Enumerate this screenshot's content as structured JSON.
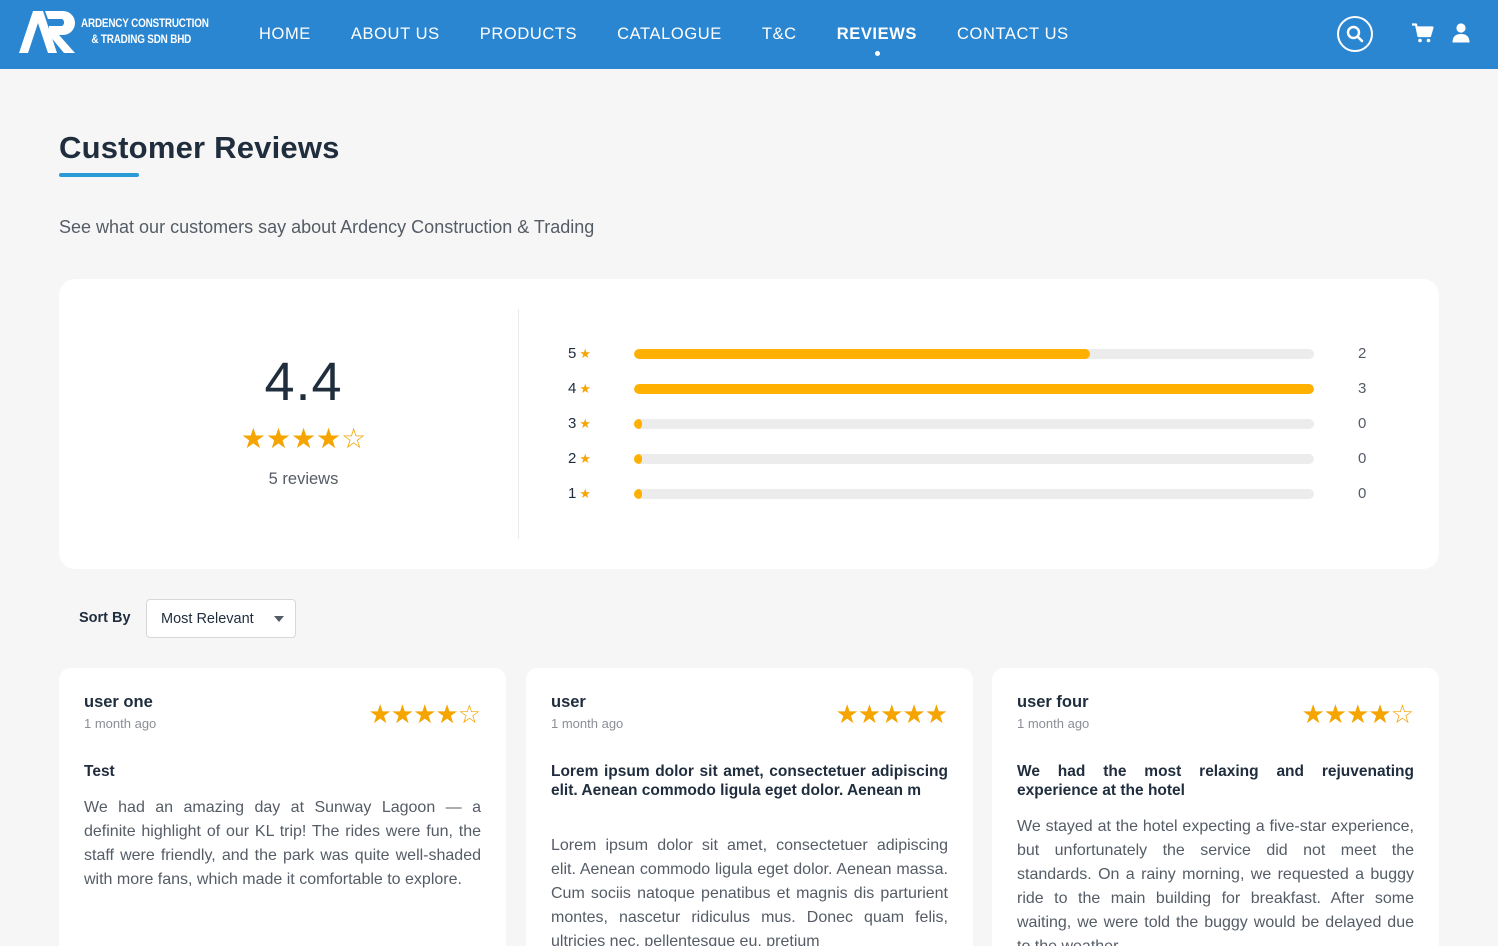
{
  "brand": {
    "name_line1": "ARDENCY CONSTRUCTION",
    "name_line2": "& TRADING SDN BHD",
    "logo_icon": "ar-logo-mark",
    "color": "#2b86d1"
  },
  "nav": {
    "items": [
      {
        "label": "HOME"
      },
      {
        "label": "ABOUT US"
      },
      {
        "label": "PRODUCTS"
      },
      {
        "label": "CATALOGUE"
      },
      {
        "label": "T&C"
      },
      {
        "label": "REVIEWS",
        "active": true
      },
      {
        "label": "CONTACT US"
      }
    ],
    "icons": [
      "search-icon",
      "cart-icon",
      "user-icon"
    ]
  },
  "page": {
    "title": "Customer Reviews",
    "subtitle": "See what our customers say about Ardency Construction & Trading"
  },
  "summary": {
    "average": "4.4",
    "stars": "★★★★☆",
    "count_text": "5 reviews",
    "breakdown": [
      {
        "stars": "5",
        "star_icon": "★",
        "count": "2",
        "fraction": 0.67
      },
      {
        "stars": "4",
        "star_icon": "★",
        "count": "3",
        "fraction": 1.0
      },
      {
        "stars": "3",
        "star_icon": "★",
        "count": "0",
        "fraction": 0
      },
      {
        "stars": "2",
        "star_icon": "★",
        "count": "0",
        "fraction": 0
      },
      {
        "stars": "1",
        "star_icon": "★",
        "count": "0",
        "fraction": 0
      }
    ],
    "bar_color": "#ffb000",
    "star_color": "#f5a400"
  },
  "sort": {
    "label": "Sort By",
    "selected": "Most Relevant"
  },
  "reviews": [
    {
      "user": "user one",
      "time": "1 month ago",
      "stars": "★★★★☆",
      "heading": "Test",
      "body": "We had an amazing day at Sunway Lagoon — a definite highlight of our KL trip! The rides were fun, the staff were friendly, and the park was quite well-shaded with more fans, which made it comfortable to explore."
    },
    {
      "user": "user",
      "time": "1 month ago",
      "stars": "★★★★★",
      "heading": "Lorem ipsum dolor sit amet, consectetuer adipiscing elit. Aenean commodo ligula eget dolor. Aenean m",
      "body": "Lorem ipsum dolor sit amet, consectetuer adipiscing elit. Aenean commodo ligula eget dolor. Aenean massa. Cum sociis natoque penatibus et magnis dis parturient montes, nascetur ridiculus mus. Donec quam felis, ultricies nec, pellentesque eu, pretium"
    },
    {
      "user": "user four",
      "time": "1 month ago",
      "stars": "★★★★☆",
      "heading": "We had the most relaxing and rejuvenating experience at the hotel",
      "body": "We stayed at the hotel expecting a five-star experience, but unfortunately the service did not meet the standards. On a rainy morning, we requested a buggy ride to the main building for breakfast. After some waiting, we were told the buggy would be delayed due to the weather."
    }
  ]
}
